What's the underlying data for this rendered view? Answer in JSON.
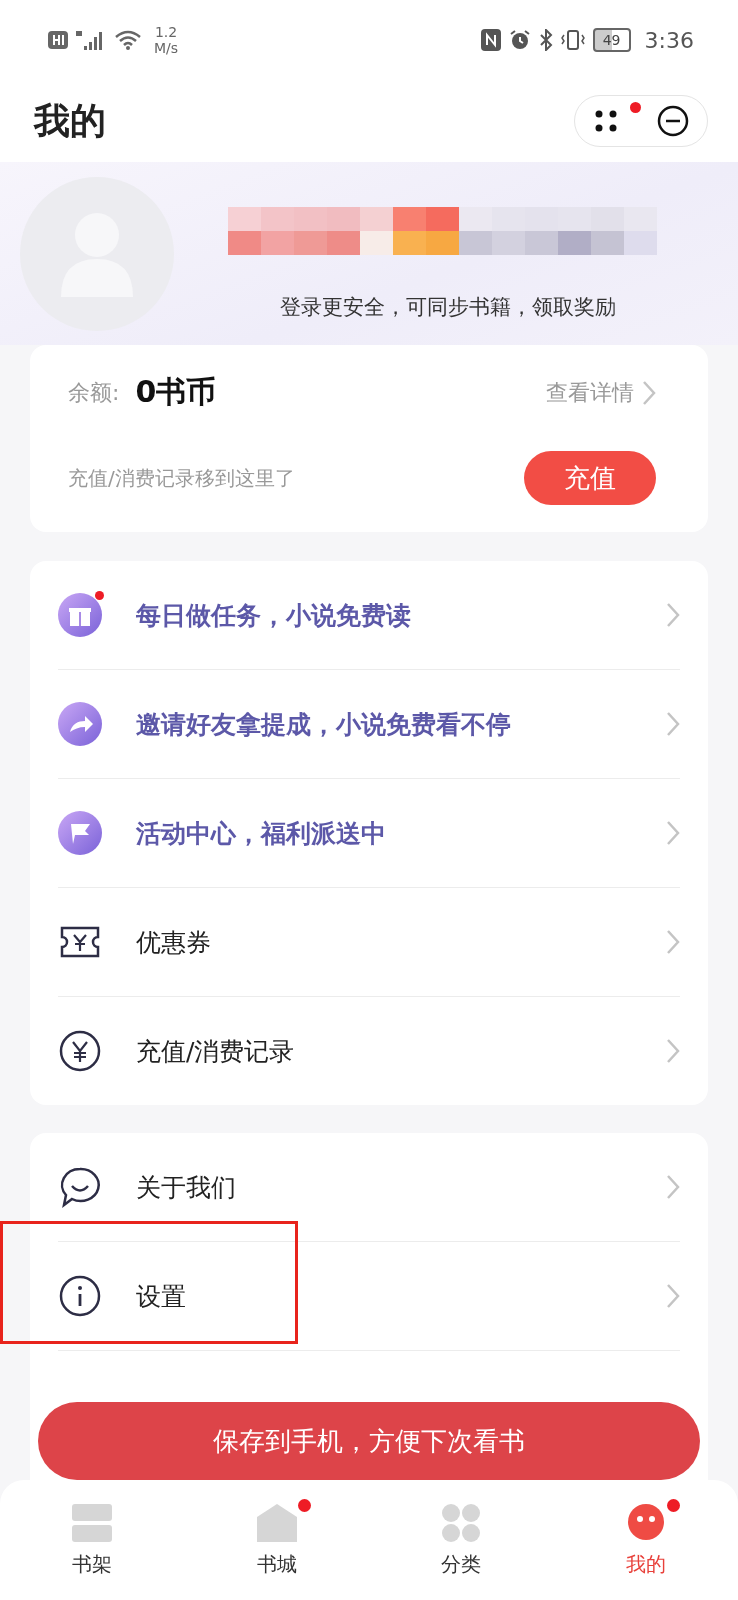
{
  "status_bar": {
    "speed_value": "1.2",
    "speed_unit": "M/s",
    "battery": "49",
    "time": "3:36"
  },
  "header": {
    "title": "我的",
    "capsule_badge": true
  },
  "profile": {
    "subtitle": "登录更安全，可同步书籍，领取奖励"
  },
  "balance": {
    "label": "余额:",
    "amount": "0书币",
    "details_link": "查看详情",
    "note": "充值/消费记录移到这里了",
    "recharge_button": "充值"
  },
  "menu_groups": [
    {
      "items": [
        {
          "kind": "promo",
          "label": "每日做任务，小说免费读",
          "badge": true,
          "annotated": false
        },
        {
          "kind": "promo",
          "label": "邀请好友拿提成，小说免费看不停",
          "badge": false,
          "annotated": false
        },
        {
          "kind": "promo",
          "label": "活动中心，福利派送中",
          "badge": false,
          "annotated": false
        },
        {
          "kind": "normal",
          "label": "优惠券",
          "badge": false,
          "annotated": false
        },
        {
          "kind": "normal",
          "label": "充值/消费记录",
          "badge": false,
          "annotated": false
        }
      ]
    },
    {
      "items": [
        {
          "kind": "normal",
          "label": "关于我们",
          "badge": false,
          "annotated": false
        },
        {
          "kind": "normal",
          "label": "设置",
          "badge": false,
          "annotated": true
        }
      ]
    }
  ],
  "save_banner": "保存到手机，方便下次看书",
  "tabs": [
    {
      "label": "书架",
      "selected": false,
      "badge": false
    },
    {
      "label": "书城",
      "selected": false,
      "badge": true
    },
    {
      "label": "分类",
      "selected": false,
      "badge": false
    },
    {
      "label": "我的",
      "selected": true,
      "badge": true
    }
  ]
}
